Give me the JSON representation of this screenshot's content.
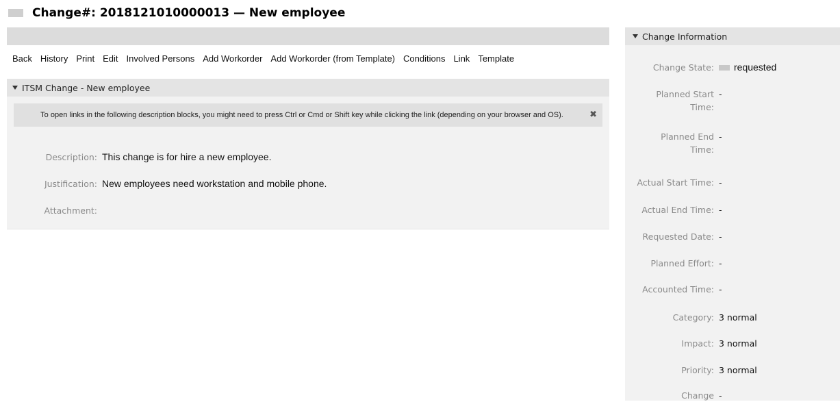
{
  "page": {
    "title": "Change#: 2018121010000013 — New employee"
  },
  "actions": [
    "Back",
    "History",
    "Print",
    "Edit",
    "Involved Persons",
    "Add Workorder",
    "Add Workorder (from Template)",
    "Conditions",
    "Link",
    "Template"
  ],
  "main_widget": {
    "title": "ITSM Change - New employee",
    "notice": "To open links in the following description blocks, you might need to press Ctrl or Cmd or Shift key while clicking the link (depending on your browser and OS).",
    "close_icon": "close-icon",
    "fields": [
      {
        "label": "Description:",
        "value": "This change is for hire a new employee."
      },
      {
        "label": "Justification:",
        "value": "New employees need workstation and mobile phone."
      },
      {
        "label": "Attachment:",
        "value": ""
      }
    ]
  },
  "side_widget": {
    "title": "Change Information",
    "state_label": "Change State:",
    "state_value": "requested",
    "rows": [
      {
        "label1": "Planned Start",
        "label2": "Time:",
        "value": "-"
      },
      {
        "label1": "Planned End",
        "label2": "Time:",
        "value": "-"
      },
      {
        "label1": "Actual Start Time:",
        "label2": "",
        "value": "-"
      },
      {
        "label1": "Actual End Time:",
        "label2": "",
        "value": "-"
      },
      {
        "label1": "Requested Date:",
        "label2": "",
        "value": "-"
      },
      {
        "label1": "Planned Effort:",
        "label2": "",
        "value": "-"
      },
      {
        "label1": "Accounted Time:",
        "label2": "",
        "value": "-"
      },
      {
        "label1": "Category:",
        "label2": "",
        "value": "3 normal"
      },
      {
        "label1": "Impact:",
        "label2": "",
        "value": "3 normal"
      },
      {
        "label1": "Priority:",
        "label2": "",
        "value": "3 normal"
      },
      {
        "label1": "Change",
        "label2": "",
        "value": "-"
      }
    ]
  }
}
